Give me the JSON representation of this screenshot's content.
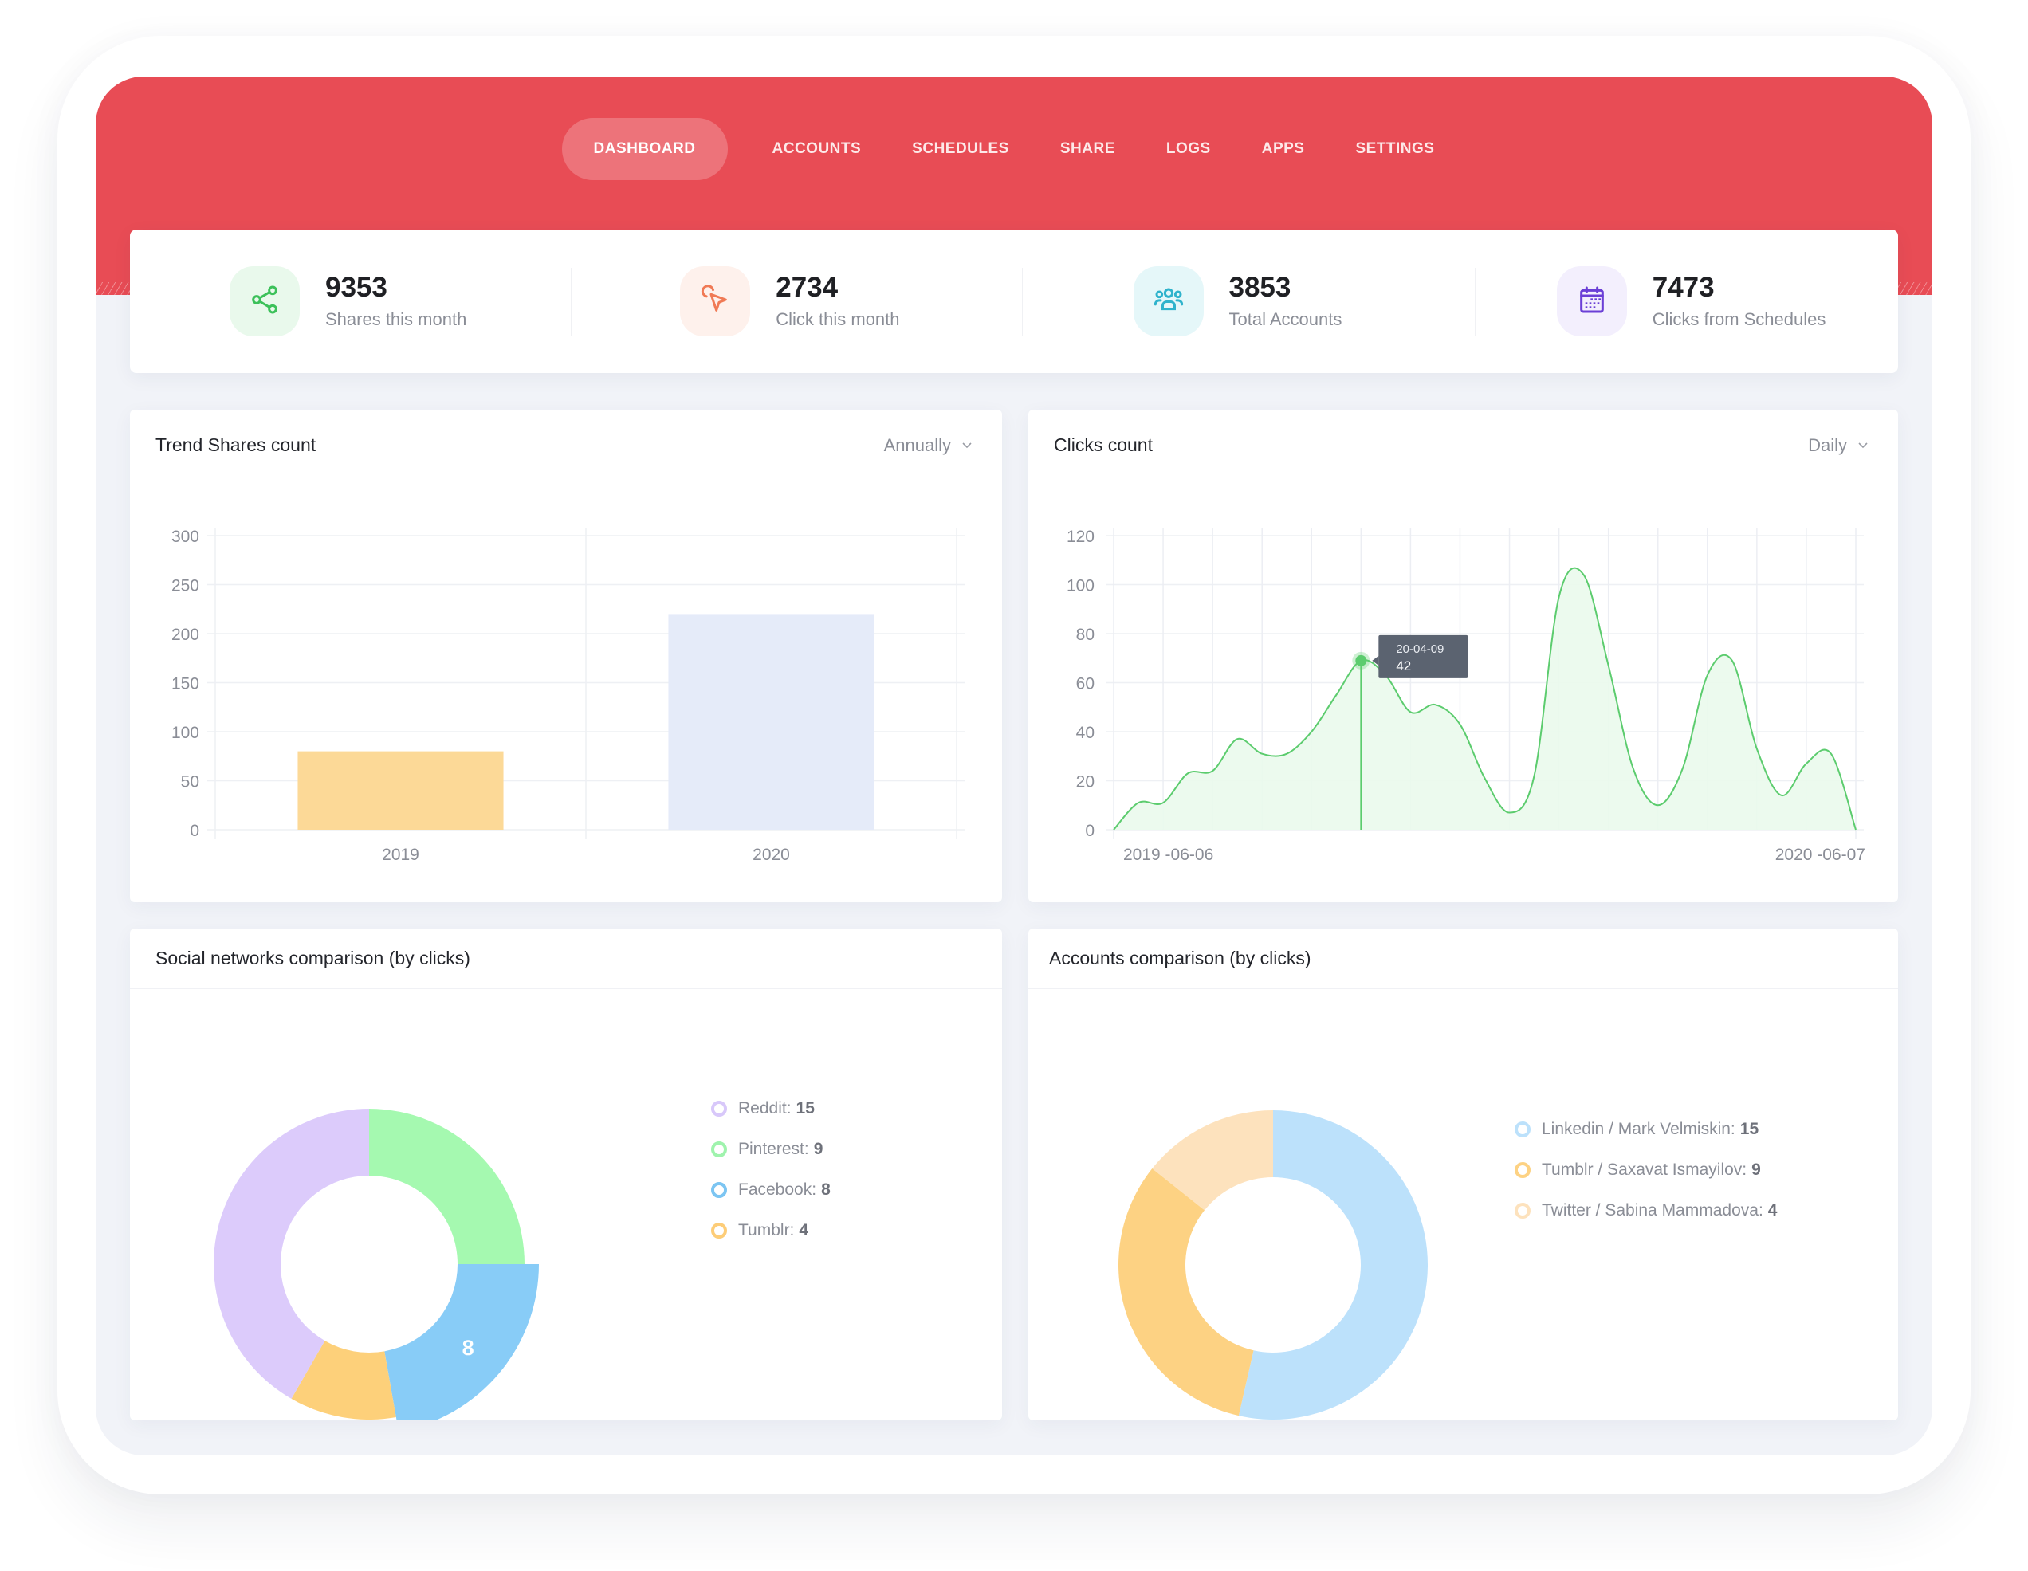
{
  "nav": {
    "items": [
      {
        "label": "DASHBOARD",
        "active": true
      },
      {
        "label": "ACCOUNTS",
        "active": false
      },
      {
        "label": "SCHEDULES",
        "active": false
      },
      {
        "label": "SHARE",
        "active": false
      },
      {
        "label": "LOGS",
        "active": false
      },
      {
        "label": "APPS",
        "active": false
      },
      {
        "label": "SETTINGS",
        "active": false
      }
    ]
  },
  "colors": {
    "brand_red": "#e84c55",
    "panel_bg": "#f1f3f8",
    "line_green": "#5ccc6e",
    "area_green": "#eafaec"
  },
  "stats": [
    {
      "icon": "share-icon",
      "value": "9353",
      "label": "Shares this month",
      "color": "#3cc15a",
      "bg": "#e9f9ec"
    },
    {
      "icon": "cursor-click-icon",
      "value": "2734",
      "label": "Click this month",
      "color": "#f07a55",
      "bg": "#fef1ec"
    },
    {
      "icon": "users-icon",
      "value": "3853",
      "label": "Total Accounts",
      "color": "#2fb3cc",
      "bg": "#e5f7f9"
    },
    {
      "icon": "calendar-icon",
      "value": "7473",
      "label": "Clicks from Schedules",
      "color": "#6b3fd6",
      "bg": "#f3effd"
    }
  ],
  "trend_card": {
    "title": "Trend Shares count",
    "period": "Annually"
  },
  "clicks_card": {
    "title": "Clicks count",
    "period": "Daily"
  },
  "social_card": {
    "title": "Social networks comparison (by clicks)"
  },
  "accounts_card": {
    "title": "Accounts comparison (by clicks)"
  },
  "chart_data": [
    {
      "type": "bar",
      "title": "Trend Shares count",
      "categories": [
        "2019",
        "2020"
      ],
      "values": [
        80,
        220
      ],
      "colors": [
        "#fcd997",
        "#e5ebf9"
      ],
      "xlabel": "",
      "ylabel": "",
      "ylim": [
        0,
        300
      ],
      "yticks": [
        0,
        50,
        100,
        150,
        200,
        250,
        300
      ],
      "grid": true
    },
    {
      "type": "area",
      "title": "Clicks count",
      "x_start_label": "2019 -06-06",
      "x_end_label": "2020 -06-07",
      "ylim": [
        0,
        120
      ],
      "yticks": [
        0,
        20,
        40,
        60,
        80,
        100,
        120
      ],
      "x_intervals": 15,
      "values": [
        0,
        11,
        11,
        23,
        24,
        37,
        31,
        31,
        40,
        55,
        69,
        63,
        48,
        51,
        43,
        21,
        7,
        22,
        95,
        104,
        67,
        25,
        10,
        25,
        63,
        69,
        33,
        14,
        27,
        31,
        0
      ],
      "grid": true,
      "tooltip": {
        "date": "20-04-09",
        "value": "42",
        "index": 10
      }
    },
    {
      "type": "pie",
      "title": "Social networks comparison (by clicks)",
      "donut": true,
      "slices": [
        {
          "label": "Pinterest",
          "value": 9,
          "color": "#a5f9b0"
        },
        {
          "label": "Facebook",
          "value": 8,
          "color": "#88ccf7",
          "highlighted": true
        },
        {
          "label": "Tumblr",
          "value": 4,
          "color": "#fdd07a"
        },
        {
          "label": "Reddit",
          "value": 15,
          "color": "#dccbfb"
        }
      ],
      "slice_label": "8",
      "legend": [
        {
          "label": "Reddit:",
          "value": "15",
          "color": "#d8c8fa"
        },
        {
          "label": "Pinterest:",
          "value": "9",
          "color": "#9ff3ad"
        },
        {
          "label": "Facebook:",
          "value": "8",
          "color": "#7cc5f2"
        },
        {
          "label": "Tumblr:",
          "value": "4",
          "color": "#fdcd78"
        }
      ],
      "legend_position": "right"
    },
    {
      "type": "pie",
      "title": "Accounts comparison (by clicks)",
      "donut": true,
      "slices": [
        {
          "label": "Linkedin / Mark Velmiskin",
          "value": 15,
          "color": "#bce1fb"
        },
        {
          "label": "Tumblr / Saxavat Ismayilov",
          "value": 9,
          "color": "#fdd283"
        },
        {
          "label": "Twitter / Sabina Mammadova",
          "value": 4,
          "color": "#fde2bd"
        }
      ],
      "legend": [
        {
          "label": "Linkedin / Mark Velmiskin:",
          "value": "15",
          "color": "#bce1fb"
        },
        {
          "label": "Tumblr / Saxavat Ismayilov:",
          "value": "9",
          "color": "#fdd283"
        },
        {
          "label": "Twitter / Sabina Mammadova:",
          "value": "4",
          "color": "#fde2bd"
        }
      ],
      "legend_position": "right"
    }
  ]
}
